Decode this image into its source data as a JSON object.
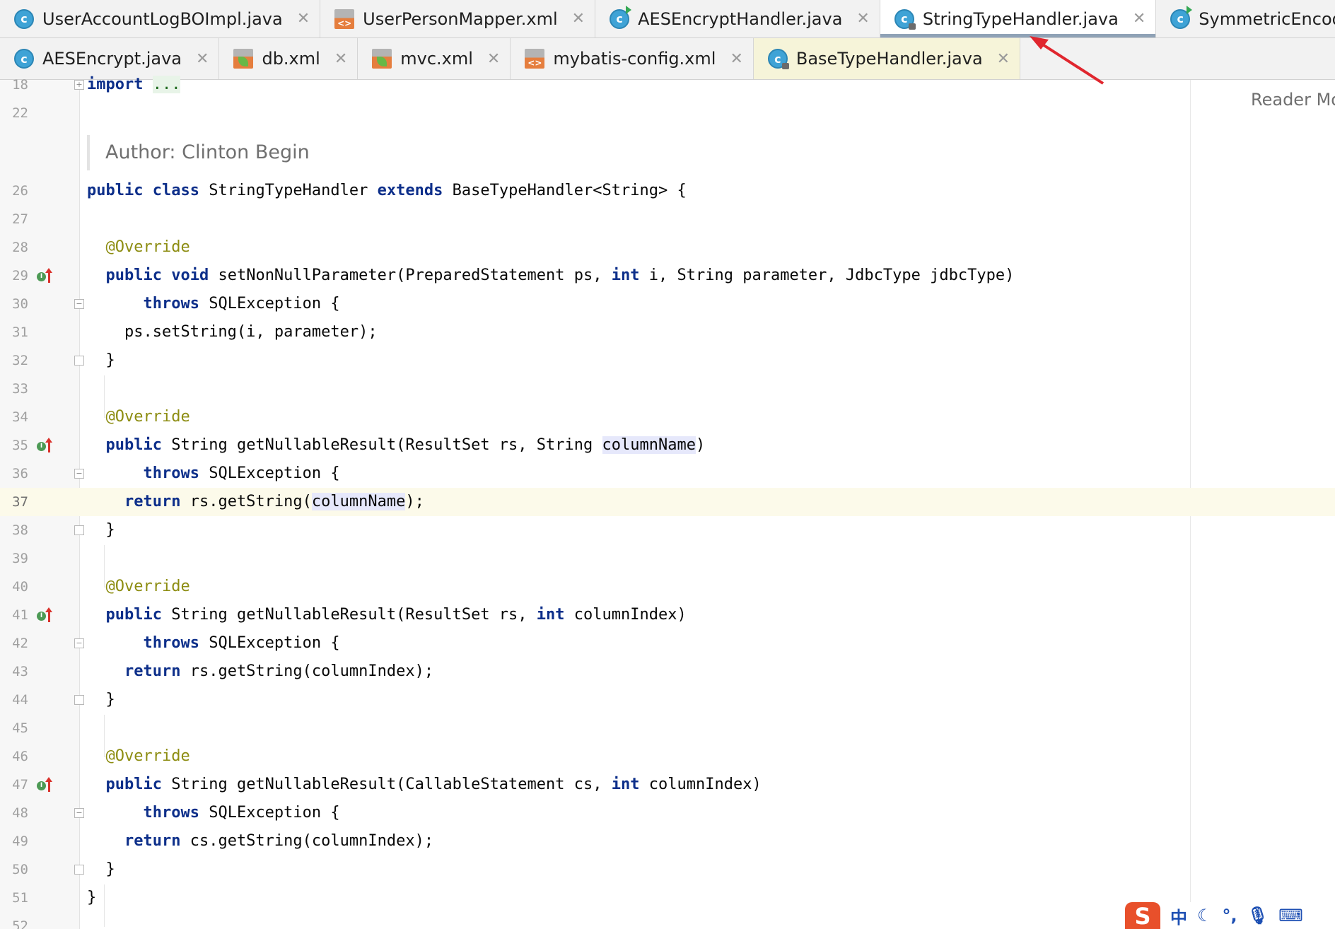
{
  "tabs_row1": [
    {
      "label": "UserAccountLogBOImpl.java",
      "icon": "java-class-icon"
    },
    {
      "label": "UserPersonMapper.xml",
      "icon": "xml-file-icon"
    },
    {
      "label": "AESEncryptHandler.java",
      "icon": "java-class-runnable-icon"
    },
    {
      "label": "StringTypeHandler.java",
      "icon": "java-class-locked-icon",
      "active": true
    },
    {
      "label": "SymmetricEncoder.java",
      "icon": "java-class-runnable-icon"
    }
  ],
  "tabs_row2": [
    {
      "label": "AESEncrypt.java",
      "icon": "java-class-icon"
    },
    {
      "label": "db.xml",
      "icon": "spring-xml-icon"
    },
    {
      "label": "mvc.xml",
      "icon": "spring-xml-icon"
    },
    {
      "label": "mybatis-config.xml",
      "icon": "xml-file-icon"
    },
    {
      "label": "BaseTypeHandler.java",
      "icon": "java-class-locked-icon",
      "selected": true
    }
  ],
  "close_glyph": "✕",
  "reader_mode": "Reader Mo",
  "doc_comment": "Author: Clinton Begin",
  "line_numbers": {
    "l18": "18",
    "l22": "22",
    "l26": "26",
    "l27": "27",
    "l28": "28",
    "l29": "29",
    "l30": "30",
    "l31": "31",
    "l32": "32",
    "l33": "33",
    "l34": "34",
    "l35": "35",
    "l36": "36",
    "l37": "37",
    "l38": "38",
    "l39": "39",
    "l40": "40",
    "l41": "41",
    "l42": "42",
    "l43": "43",
    "l44": "44",
    "l45": "45",
    "l46": "46",
    "l47": "47",
    "l48": "48",
    "l49": "49",
    "l50": "50",
    "l51": "51",
    "l52": "52"
  },
  "code": {
    "import_kw": "import",
    "import_dots": "...",
    "l26": {
      "kw1": "public",
      "kw2": "class",
      "name": " StringTypeHandler ",
      "kw3": "extends",
      "rest": " BaseTypeHandler<String> {"
    },
    "override": "@Override",
    "l29": {
      "kw1": "public",
      "kw2": "void",
      "a": " setNonNullParameter(PreparedStatement ps, ",
      "kw3": "int",
      "b": " i, String parameter, JdbcType jdbcType)"
    },
    "throws_kw": "throws",
    "throws_rest": " SQLException {",
    "l31": "ps.setString(i, parameter);",
    "close_brace": "}",
    "l35": {
      "kw1": "public",
      "a": " String getNullableResult(ResultSet rs, String ",
      "hl": "columnName",
      "b": ")"
    },
    "return_kw": "return",
    "l37": {
      "a": " rs.getString(",
      "hl": "columnName",
      "b": ");"
    },
    "l41": {
      "kw1": "public",
      "a": " String getNullableResult(ResultSet rs, ",
      "kw2": "int",
      "b": " columnIndex)"
    },
    "l43": " rs.getString(columnIndex);",
    "l47": {
      "kw1": "public",
      "a": " String getNullableResult(CallableStatement cs, ",
      "kw2": "int",
      "b": " columnIndex)"
    },
    "l49": " cs.getString(columnIndex);"
  },
  "ime": {
    "logo": "S",
    "lang": "中"
  },
  "colors": {
    "keyword": "#0d2f8a",
    "annotation": "#8d8d12",
    "arrow": "#e0262e",
    "current_line": "#fcfaea"
  }
}
